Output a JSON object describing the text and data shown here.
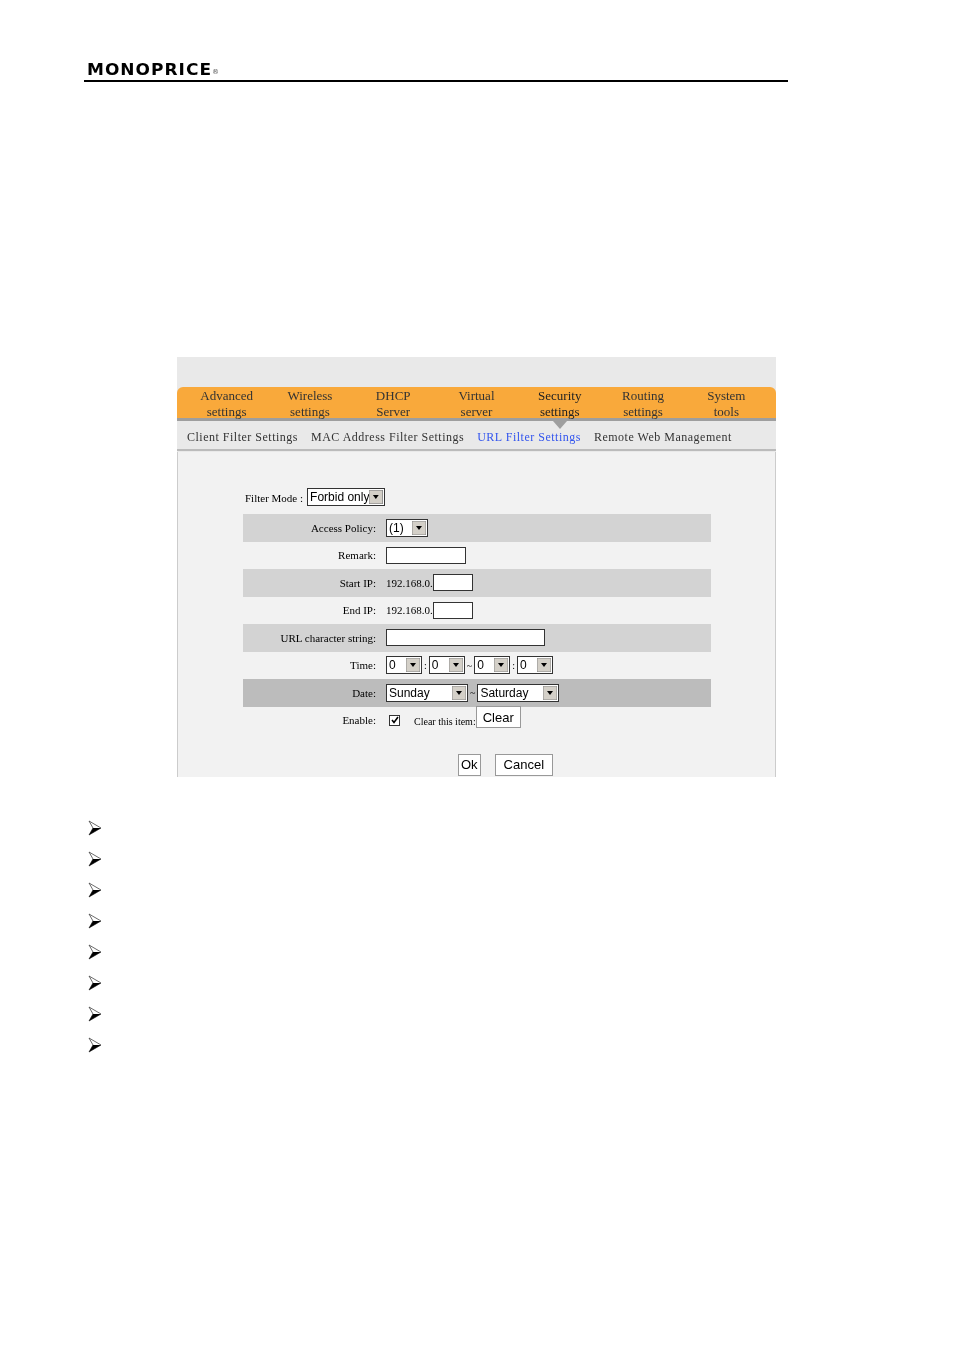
{
  "header": {
    "logo": "MONOPRICE",
    "logo_mark": "®"
  },
  "router": {
    "nav_tabs": [
      {
        "label": "Advanced\nsettings",
        "selected": false
      },
      {
        "label": "Wireless\nsettings",
        "selected": false
      },
      {
        "label": "DHCP\nServer",
        "selected": false
      },
      {
        "label": "Virtual\nserver",
        "selected": false
      },
      {
        "label": "Security\nsettings",
        "selected": true
      },
      {
        "label": "Routing\nsettings",
        "selected": false
      },
      {
        "label": "System\ntools",
        "selected": false
      }
    ],
    "sub_tabs": [
      {
        "label": "Client Filter Settings",
        "selected": false
      },
      {
        "label": "MAC Address Filter Settings",
        "selected": false
      },
      {
        "label": "URL Filter Settings",
        "selected": true
      },
      {
        "label": "Remote Web Management",
        "selected": false
      }
    ],
    "filter_mode": {
      "label": "Filter Mode :",
      "value": "Forbid only"
    },
    "rows": [
      {
        "kind": "select",
        "label": "Access Policy:",
        "value": "(1)",
        "color": "#d3d3d3"
      },
      {
        "kind": "text",
        "label": "Remark:"
      },
      {
        "kind": "ip",
        "label": "Start IP:",
        "prefix": "192.168.0.",
        "color": "#d3d3d3"
      },
      {
        "kind": "ip",
        "label": "End IP:",
        "prefix": "192.168.0."
      },
      {
        "kind": "longtext",
        "label": "URL character string:",
        "color": "#d3d3d3"
      },
      {
        "kind": "time",
        "label": "Time:",
        "values": [
          "0",
          "0",
          "0",
          "0"
        ],
        "separators": [
          ":",
          "~",
          ":"
        ]
      },
      {
        "kind": "date",
        "label": "Date:",
        "values": [
          "Sunday",
          "Saturday"
        ],
        "separator": "~",
        "color": "#bcbcbc"
      },
      {
        "kind": "enable",
        "label": "Enable:",
        "checked": true,
        "clear_label": "Clear this item:",
        "button": "Clear"
      }
    ],
    "buttons": [
      "Ok",
      "Cancel"
    ]
  },
  "bullets": [
    {
      "kind": "arrow"
    },
    {
      "kind": "arrow"
    },
    {
      "kind": "arrow"
    },
    {
      "kind": "arrow"
    },
    {
      "kind": "arrow"
    },
    {
      "kind": "arrow"
    },
    {
      "kind": "arrow"
    },
    {
      "kind": "arrow"
    }
  ]
}
